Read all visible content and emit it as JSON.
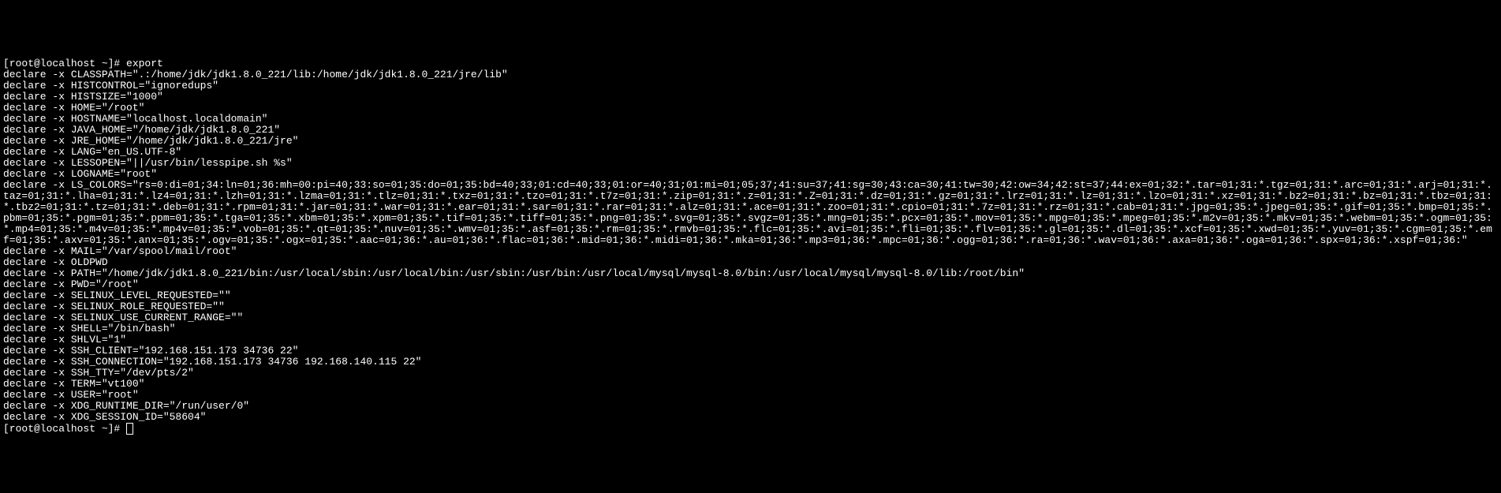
{
  "terminal": {
    "prompt1": "[root@localhost ~]# export",
    "lines": [
      "declare -x CLASSPATH=\".:/home/jdk/jdk1.8.0_221/lib:/home/jdk/jdk1.8.0_221/jre/lib\"",
      "declare -x HISTCONTROL=\"ignoredups\"",
      "declare -x HISTSIZE=\"1000\"",
      "declare -x HOME=\"/root\"",
      "declare -x HOSTNAME=\"localhost.localdomain\"",
      "declare -x JAVA_HOME=\"/home/jdk/jdk1.8.0_221\"",
      "declare -x JRE_HOME=\"/home/jdk/jdk1.8.0_221/jre\"",
      "declare -x LANG=\"en_US.UTF-8\"",
      "declare -x LESSOPEN=\"||/usr/bin/lesspipe.sh %s\"",
      "declare -x LOGNAME=\"root\"",
      "declare -x LS_COLORS=\"rs=0:di=01;34:ln=01;36:mh=00:pi=40;33:so=01;35:do=01;35:bd=40;33;01:cd=40;33;01:or=40;31;01:mi=01;05;37;41:su=37;41:sg=30;43:ca=30;41:tw=30;42:ow=34;42:st=37;44:ex=01;32:*.tar=01;31:*.tgz=01;31:*.arc=01;31:*.arj=01;31:*.taz=01;31:*.lha=01;31:*.lz4=01;31:*.lzh=01;31:*.lzma=01;31:*.tlz=01;31:*.txz=01;31:*.tzo=01;31:*.t7z=01;31:*.zip=01;31:*.z=01;31:*.Z=01;31:*.dz=01;31:*.gz=01;31:*.lrz=01;31:*.lz=01;31:*.lzo=01;31:*.xz=01;31:*.bz2=01;31:*.bz=01;31:*.tbz=01;31:*.tbz2=01;31:*.tz=01;31:*.deb=01;31:*.rpm=01;31:*.jar=01;31:*.war=01;31:*.ear=01;31:*.sar=01;31:*.rar=01;31:*.alz=01;31:*.ace=01;31:*.zoo=01;31:*.cpio=01;31:*.7z=01;31:*.rz=01;31:*.cab=01;31:*.jpg=01;35:*.jpeg=01;35:*.gif=01;35:*.bmp=01;35:*.pbm=01;35:*.pgm=01;35:*.ppm=01;35:*.tga=01;35:*.xbm=01;35:*.xpm=01;35:*.tif=01;35:*.tiff=01;35:*.png=01;35:*.svg=01;35:*.svgz=01;35:*.mng=01;35:*.pcx=01;35:*.mov=01;35:*.mpg=01;35:*.mpeg=01;35:*.m2v=01;35:*.mkv=01;35:*.webm=01;35:*.ogm=01;35:*.mp4=01;35:*.m4v=01;35:*.mp4v=01;35:*.vob=01;35:*.qt=01;35:*.nuv=01;35:*.wmv=01;35:*.asf=01;35:*.rm=01;35:*.rmvb=01;35:*.flc=01;35:*.avi=01;35:*.fli=01;35:*.flv=01;35:*.gl=01;35:*.dl=01;35:*.xcf=01;35:*.xwd=01;35:*.yuv=01;35:*.cgm=01;35:*.emf=01;35:*.axv=01;35:*.anx=01;35:*.ogv=01;35:*.ogx=01;35:*.aac=01;36:*.au=01;36:*.flac=01;36:*.mid=01;36:*.midi=01;36:*.mka=01;36:*.mp3=01;36:*.mpc=01;36:*.ogg=01;36:*.ra=01;36:*.wav=01;36:*.axa=01;36:*.oga=01;36:*.spx=01;36:*.xspf=01;36:\"",
      "declare -x MAIL=\"/var/spool/mail/root\"",
      "declare -x OLDPWD",
      "declare -x PATH=\"/home/jdk/jdk1.8.0_221/bin:/usr/local/sbin:/usr/local/bin:/usr/sbin:/usr/bin:/usr/local/mysql/mysql-8.0/bin:/usr/local/mysql/mysql-8.0/lib:/root/bin\"",
      "declare -x PWD=\"/root\"",
      "declare -x SELINUX_LEVEL_REQUESTED=\"\"",
      "declare -x SELINUX_ROLE_REQUESTED=\"\"",
      "declare -x SELINUX_USE_CURRENT_RANGE=\"\"",
      "declare -x SHELL=\"/bin/bash\"",
      "declare -x SHLVL=\"1\"",
      "declare -x SSH_CLIENT=\"192.168.151.173 34736 22\"",
      "declare -x SSH_CONNECTION=\"192.168.151.173 34736 192.168.140.115 22\"",
      "declare -x SSH_TTY=\"/dev/pts/2\"",
      "declare -x TERM=\"vt100\"",
      "declare -x USER=\"root\"",
      "declare -x XDG_RUNTIME_DIR=\"/run/user/0\"",
      "declare -x XDG_SESSION_ID=\"58604\""
    ],
    "prompt2": "[root@localhost ~]# "
  }
}
